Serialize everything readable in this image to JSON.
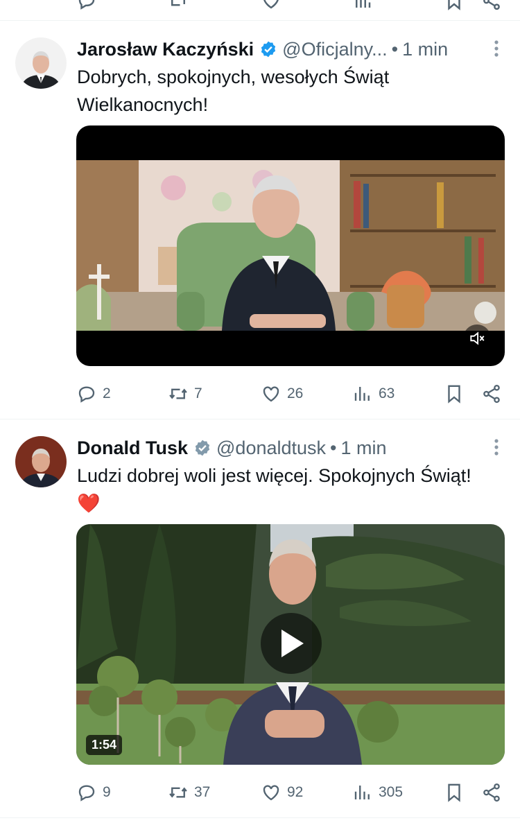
{
  "tweets": [
    {
      "name": "Jarosław Kaczyński",
      "handle": "@Oficjalny...",
      "dot": "•",
      "time": "1 min",
      "text": "Dobrych, spokojnych, wesołych Świąt Wielkanocnych!",
      "video": {
        "muted": true
      },
      "stats": {
        "replies": "2",
        "reposts": "7",
        "likes": "26",
        "views": "63"
      }
    },
    {
      "name": "Donald Tusk",
      "handle": "@donaldtusk",
      "dot": "•",
      "time": "1 min",
      "text": "Ludzi dobrej woli jest więcej. Spokojnych Świąt! ❤️",
      "video": {
        "duration": "1:54"
      },
      "stats": {
        "replies": "9",
        "reposts": "37",
        "likes": "92",
        "views": "305"
      }
    }
  ],
  "icons": {
    "verified_color": "#1d9bf0",
    "verified_gray_color": "#829aab",
    "action_color": "#536471"
  }
}
